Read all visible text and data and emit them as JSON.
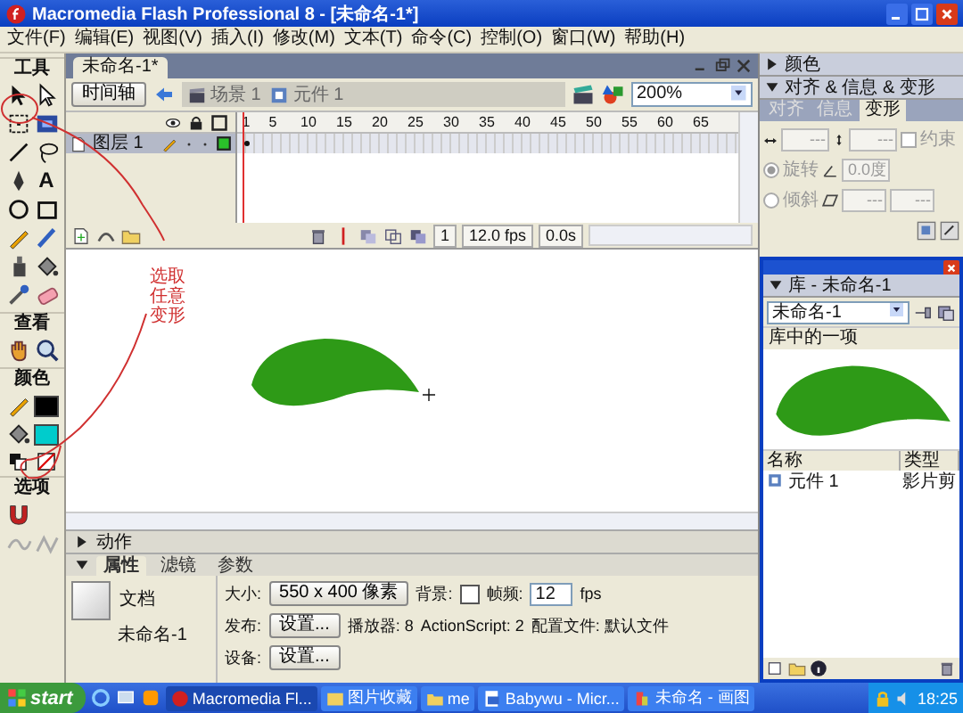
{
  "window": {
    "title": "Macromedia Flash Professional 8 - [未命名-1*]"
  },
  "menu": [
    "文件(F)",
    "编辑(E)",
    "视图(V)",
    "插入(I)",
    "修改(M)",
    "文本(T)",
    "命令(C)",
    "控制(O)",
    "窗口(W)",
    "帮助(H)"
  ],
  "tools": {
    "title": "工具",
    "text_tool": "A",
    "view_title": "查看",
    "color_title": "颜色",
    "options_title": "选项"
  },
  "document_tab": {
    "label": "未命名-1*"
  },
  "timeline": {
    "button": "时间轴",
    "breadcrumbs": [
      "场景 1",
      "元件 1"
    ],
    "zoom": "200%",
    "ruler": [
      "1",
      "5",
      "10",
      "15",
      "20",
      "25",
      "30",
      "35",
      "40",
      "45",
      "50",
      "55",
      "60",
      "65"
    ],
    "layers": [
      {
        "name": "图层 1",
        "selected": true
      }
    ],
    "current_frame": "1",
    "frame_rate": "12.0 fps",
    "elapsed": "0.0s"
  },
  "annotation": {
    "lines": [
      "选取",
      "任意",
      "变形"
    ]
  },
  "actions_panel": {
    "title": "动作",
    "expanded": false
  },
  "properties": {
    "expanded": true,
    "tabs": [
      {
        "label": "属性",
        "selected": true
      },
      {
        "label": "滤镜",
        "selected": false
      },
      {
        "label": "参数",
        "selected": false
      }
    ],
    "doc_type": "文档",
    "doc_name": "未命名-1",
    "size_label": "大小:",
    "size_button": "550 x 400 像素",
    "background_label": "背景:",
    "frame_rate_label": "帧频:",
    "frame_rate": "12",
    "frame_rate_unit": "fps",
    "publish_label": "发布:",
    "publish_button": "设置...",
    "player": "播放器: 8",
    "actionscript": "ActionScript: 2",
    "profile": "配置文件: 默认文件",
    "device_label": "设备:",
    "device_button": "设置..."
  },
  "color_panel": {
    "title": "颜色",
    "expanded": false
  },
  "transform_panel": {
    "title": "对齐 & 信息 & 变形",
    "expanded": true,
    "tabs": [
      {
        "label": "对齐",
        "selected": false
      },
      {
        "label": "信息",
        "selected": false
      },
      {
        "label": "变形",
        "selected": true
      }
    ],
    "width": "---",
    "height": "---",
    "constrain_label": "约束",
    "constrain": false,
    "modes": [
      {
        "label": "旋转",
        "selected": true
      },
      {
        "label": "倾斜",
        "selected": false
      }
    ],
    "rotate_value": "0.0度",
    "skew_values": [
      "---",
      "---"
    ]
  },
  "library": {
    "title": "库 - 未命名-1",
    "document": "未命名-1",
    "count": "库中的一项",
    "columns": [
      "名称",
      "类型"
    ],
    "items": [
      {
        "name": "元件 1",
        "type": "影片剪",
        "selected": false
      }
    ]
  },
  "taskbar": {
    "start": "start",
    "tasks": [
      {
        "label": "Macromedia Fl...",
        "selected": true
      },
      {
        "label": "图片收藏",
        "selected": false
      },
      {
        "label": "me",
        "selected": false
      },
      {
        "label": "Babywu - Micr...",
        "selected": false
      },
      {
        "label": "未命名 - 画图",
        "selected": false
      }
    ],
    "clock": "18:25"
  }
}
